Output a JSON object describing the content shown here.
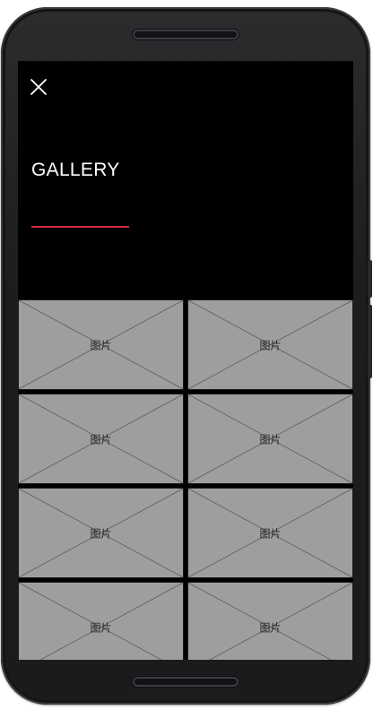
{
  "gallery": {
    "title": "GALLERY",
    "accent_color": "#d8283f",
    "close_icon": "close-icon",
    "tiles": [
      {
        "label": "图片"
      },
      {
        "label": "图片"
      },
      {
        "label": "图片"
      },
      {
        "label": "图片"
      },
      {
        "label": "图片"
      },
      {
        "label": "图片"
      },
      {
        "label": "图片"
      },
      {
        "label": "图片"
      }
    ]
  }
}
